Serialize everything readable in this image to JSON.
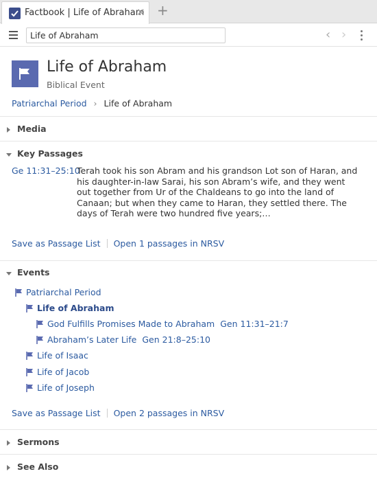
{
  "tab": {
    "title": "Factbook | Life of Abraham",
    "close_glyph": "✕",
    "add_glyph": "+"
  },
  "toolbar": {
    "search_value": "Life of Abraham",
    "back_glyph": "‹",
    "forward_glyph": "›"
  },
  "header": {
    "title": "Life of Abraham",
    "subtitle": "Biblical Event",
    "breadcrumb": [
      {
        "label": "Patriarchal Period"
      },
      {
        "label": "Life of Abraham"
      }
    ],
    "breadcrumb_sep": "›"
  },
  "sections": {
    "media": "Media",
    "key_passages": "Key Passages",
    "events": "Events",
    "sermons": "Sermons",
    "see_also": "See Also"
  },
  "key_passages": {
    "ref": "Ge 11:31–25:10",
    "text": "Terah took his son Abram and his grandson Lot son of Haran, and his daughter-in-law Sarai, his son Abram’s wife, and they went out together from Ur of the Chaldeans to go into the land of Canaan; but when they came to Haran, they settled there. The days of Terah were two hundred five years;…",
    "save_label": "Save as Passage List",
    "open_label": "Open 1 passages in NRSV"
  },
  "events": {
    "items": [
      {
        "label": "Patriarchal Period",
        "ref": ""
      },
      {
        "label": "Life of Abraham",
        "ref": ""
      },
      {
        "label": "God Fulfills Promises Made to Abraham",
        "ref": "Gen 11:31–21:7"
      },
      {
        "label": "Abraham’s Later Life",
        "ref": "Gen 21:8–25:10"
      },
      {
        "label": "Life of Isaac",
        "ref": ""
      },
      {
        "label": "Life of Jacob",
        "ref": ""
      },
      {
        "label": "Life of Joseph",
        "ref": ""
      }
    ],
    "save_label": "Save as Passage List",
    "open_label": "Open 2 passages in NRSV"
  },
  "colors": {
    "accent": "#2b5aa0",
    "icon_bg": "#5a6ab0",
    "tab_icon_bg": "#3c4e8c"
  },
  "icons": {
    "tab": "checkbox-icon",
    "menu": "hamburger-icon",
    "entity": "flag-icon",
    "event": "flag-icon",
    "more": "kebab-icon"
  }
}
